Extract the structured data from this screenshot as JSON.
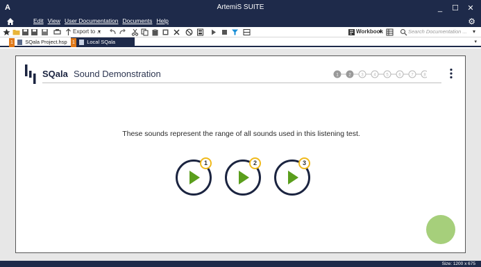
{
  "window": {
    "app_logo": "A",
    "title": "ArtemiS SUITE",
    "minimize": "_",
    "maximize": "☐",
    "close": "✕"
  },
  "menu": {
    "items": [
      "Edit",
      "View",
      "User Documentation",
      "Documents",
      "Help"
    ]
  },
  "toolbar": {
    "export_label": "Export to ...",
    "workbook_label": "Workbook",
    "search_placeholder": "Search Documentation ..."
  },
  "tabs": [
    {
      "num": "1",
      "label": "SQala Project.hsp",
      "close": "✕"
    },
    {
      "num": "1",
      "label": "Local SQala Session",
      "close": "✕"
    }
  ],
  "tab_dropdown": "▾",
  "panel": {
    "brand": "SQala",
    "heading": "Sound Demonstration",
    "steps_total": 8,
    "steps_active": 2,
    "instruction": "These sounds represent the range of all sounds used in this listening test.",
    "sounds": [
      {
        "label": "1"
      },
      {
        "label": "2"
      },
      {
        "label": "3"
      }
    ]
  },
  "colors": {
    "header_bg": "#1e2a4a",
    "tab_accent": "#e07a1a",
    "play_green": "#5a9e1c",
    "badge_yellow": "#f0b91b",
    "fab_green": "#a6cf7b",
    "step_active": "#9a9a9a"
  },
  "icons": [
    "home-icon",
    "gear-icon",
    "favorite-icon",
    "folder-icon",
    "save-icon",
    "undo-icon",
    "redo-icon",
    "cut-icon",
    "copy-icon",
    "paste-icon",
    "delete-icon",
    "play-icon",
    "stop-icon",
    "filter-icon",
    "search-icon",
    "kebab-menu-icon"
  ],
  "status": {
    "size": "Size: 1200 x 675"
  }
}
